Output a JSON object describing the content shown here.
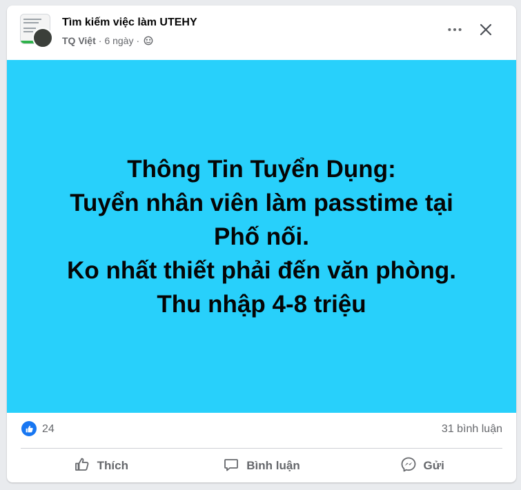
{
  "header": {
    "group_name": "Tìm kiếm việc làm UTEHY",
    "author": "TQ Việt",
    "separator": "·",
    "time": "6 ngày"
  },
  "post": {
    "lines": [
      "Thông Tin Tuyển Dụng:",
      "Tuyển nhân viên làm passtime tại",
      "Phố nối.",
      "Ko nhất thiết phải đến văn phòng.",
      "Thu nhập 4-8 triệu"
    ],
    "background_color": "#28d0fb"
  },
  "reactions": {
    "like_count": "24",
    "comment_count": "31 bình luận"
  },
  "actions": {
    "like_label": "Thích",
    "comment_label": "Bình luận",
    "send_label": "Gửi"
  },
  "icons": {
    "globe": "globe-icon",
    "more": "more-icon",
    "close": "close-icon",
    "like_badge": "thumbs-up-icon",
    "like": "thumbs-up-outline-icon",
    "comment": "comment-bubble-icon",
    "send": "messenger-icon"
  },
  "colors": {
    "accent": "#1877f2",
    "secondary_text": "#65676b"
  }
}
